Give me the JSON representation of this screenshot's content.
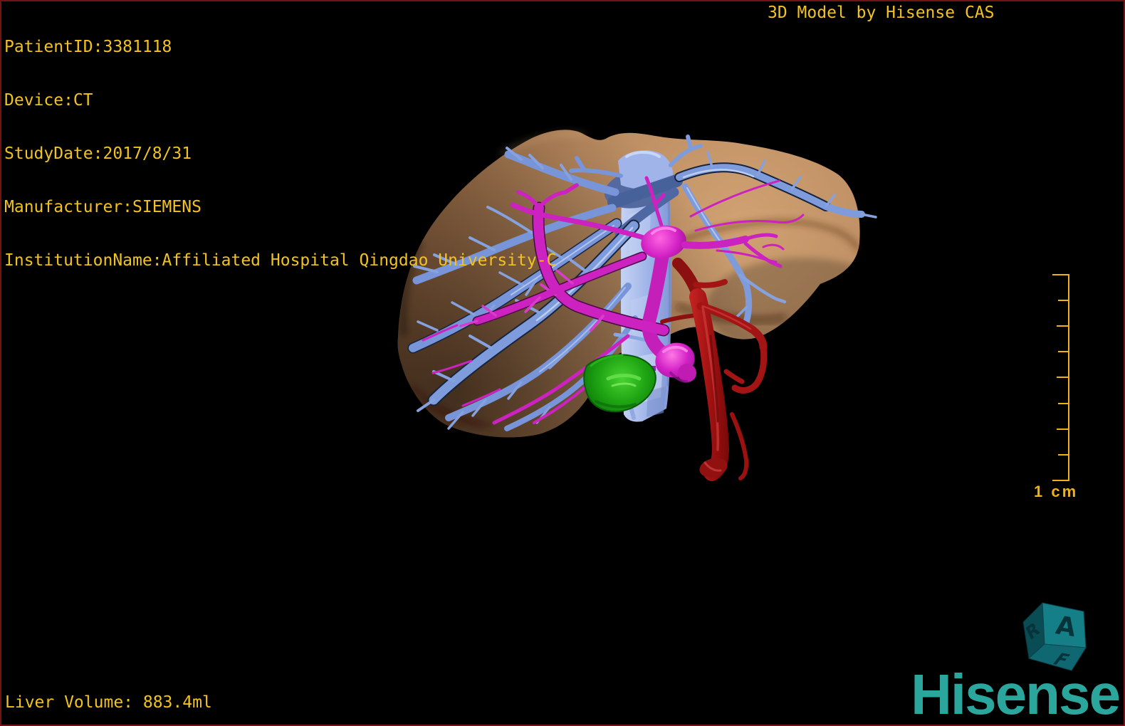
{
  "window": {
    "background": "#000000",
    "border_color": "#701414",
    "overlay_text_color": "#f2c31e"
  },
  "overlay_text": {
    "patient_info": {
      "patient_id": "PatientID:3381118",
      "device": "Device:CT",
      "study_date": "StudyDate:2017/8/31",
      "manufacturer": "Manufacturer:SIEMENS",
      "institution": "InstitutionName:Affiliated Hospital Qingdao University-C"
    },
    "watermark": "3D Model by Hisense CAS",
    "liver_volume": "Liver Volume: 883.4ml"
  },
  "scale_bar": {
    "label": "1 cm",
    "tick_count": 9,
    "color": "#f0b018"
  },
  "orientation_cube": {
    "front": "A",
    "left": "R",
    "bottom": "F",
    "face_color": "#157f88"
  },
  "logo": {
    "text": "Hisense",
    "color": "#2ba69d"
  },
  "model": {
    "structures": [
      {
        "name": "liver",
        "color": "#b5835c"
      },
      {
        "name": "hepatic-veins-and-ivc",
        "color": "#7e9ddd"
      },
      {
        "name": "portal-vein",
        "color": "#cc1ec2"
      },
      {
        "name": "hepatic-artery",
        "color": "#a31414"
      },
      {
        "name": "gallbladder",
        "color": "#1ca212"
      }
    ]
  }
}
